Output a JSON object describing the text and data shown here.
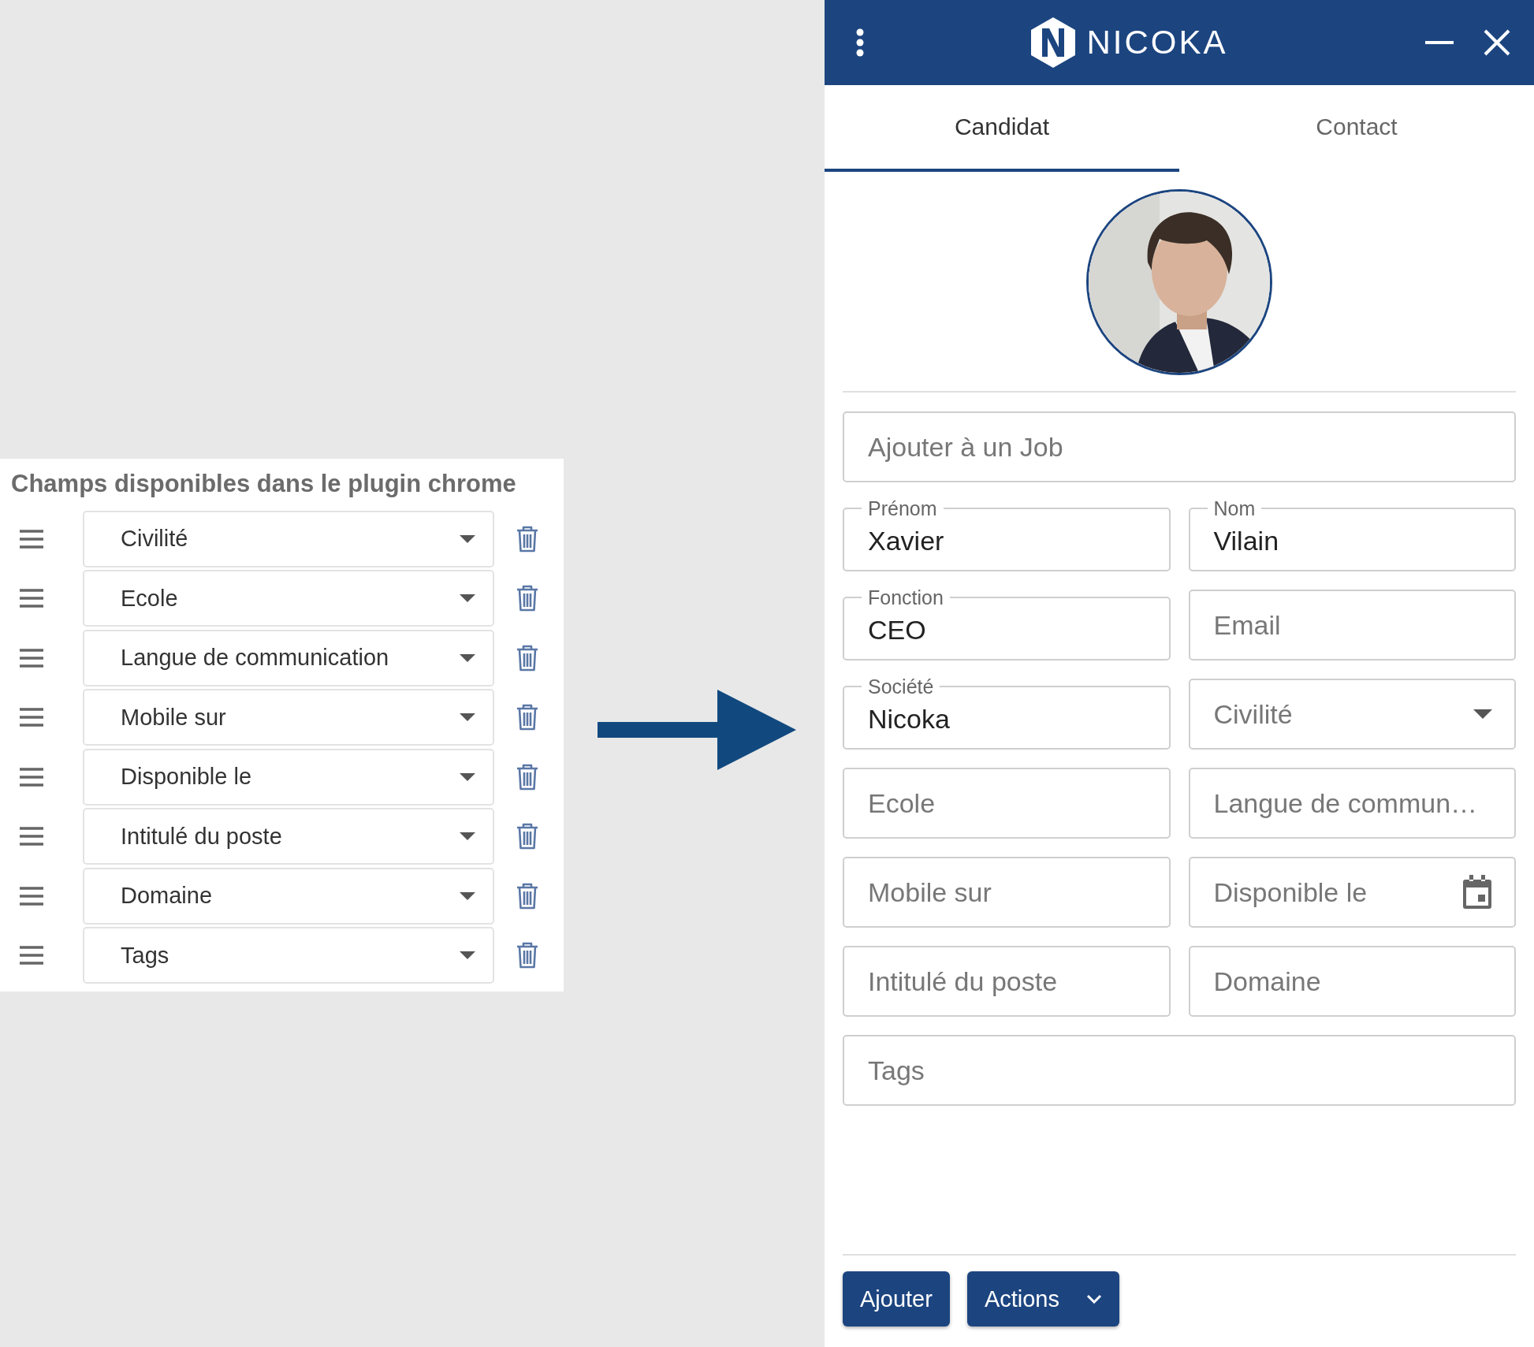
{
  "fields_panel": {
    "title": "Champs disponibles dans le plugin chrome",
    "items": [
      "Civilité",
      "Ecole",
      "Langue de communication",
      "Mobile sur",
      "Disponible le",
      "Intitulé du poste",
      "Domaine",
      "Tags"
    ]
  },
  "plugin": {
    "header": {
      "title": "NICOKA"
    },
    "tabs": [
      {
        "label": "Candidat",
        "selected": true
      },
      {
        "label": "Contact",
        "selected": false
      }
    ],
    "form": {
      "rows": [
        [
          {
            "kind": "input",
            "placeholder": "Ajouter à un Job"
          }
        ],
        [
          {
            "kind": "input",
            "label": "Prénom",
            "value": "Xavier"
          },
          {
            "kind": "input",
            "label": "Nom",
            "value": "Vilain"
          }
        ],
        [
          {
            "kind": "input",
            "label": "Fonction",
            "value": "CEO"
          },
          {
            "kind": "input",
            "placeholder": "Email"
          }
        ],
        [
          {
            "kind": "input",
            "label": "Société",
            "value": "Nicoka"
          },
          {
            "kind": "select",
            "placeholder": "Civilité"
          }
        ],
        [
          {
            "kind": "input",
            "placeholder": "Ecole"
          },
          {
            "kind": "input",
            "placeholder": "Langue de commun…"
          }
        ],
        [
          {
            "kind": "input",
            "placeholder": "Mobile sur"
          },
          {
            "kind": "date",
            "placeholder": "Disponible le"
          }
        ],
        [
          {
            "kind": "input",
            "placeholder": "Intitulé du poste"
          },
          {
            "kind": "input",
            "placeholder": "Domaine"
          }
        ],
        [
          {
            "kind": "input",
            "placeholder": "Tags"
          }
        ]
      ]
    },
    "buttons": [
      {
        "kind": "button",
        "label": "Ajouter"
      },
      {
        "kind": "menu",
        "label": "Actions"
      }
    ]
  }
}
